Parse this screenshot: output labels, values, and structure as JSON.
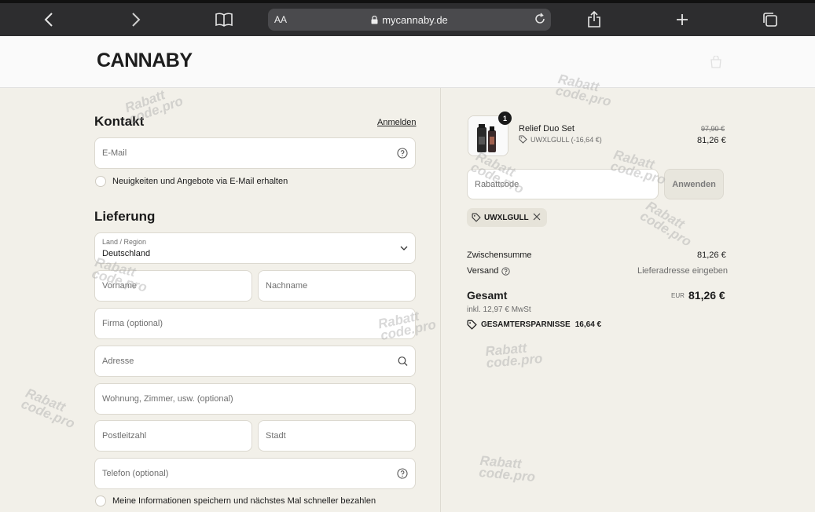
{
  "browser": {
    "aa_label": "AA",
    "url": "mycannaby.de"
  },
  "site": {
    "logo": "CANNABY"
  },
  "contact": {
    "title": "Kontakt",
    "login_link": "Anmelden",
    "email_placeholder": "E-Mail",
    "newsletter_label": "Neuigkeiten und Angebote via E-Mail erhalten"
  },
  "delivery": {
    "title": "Lieferung",
    "country_label": "Land / Region",
    "country_value": "Deutschland",
    "first_name": "Vorname",
    "last_name": "Nachname",
    "company": "Firma (optional)",
    "address": "Adresse",
    "apartment": "Wohnung, Zimmer, usw. (optional)",
    "postal_code": "Postleitzahl",
    "city": "Stadt",
    "phone": "Telefon (optional)",
    "save_info_label": "Meine Informationen speichern und nächstes Mal schneller bezahlen"
  },
  "summary": {
    "item": {
      "quantity": "1",
      "name": "Relief Duo Set",
      "discount": "UWXLGULL (-16,64 €)",
      "original_price": "97,90 €",
      "price": "81,26 €"
    },
    "discount_placeholder": "Rabattcode",
    "apply_button": "Anwenden",
    "applied_code": "UWXLGULL",
    "subtotal_label": "Zwischensumme",
    "subtotal_value": "81,26 €",
    "shipping_label": "Versand",
    "shipping_value": "Lieferadresse eingeben",
    "total_label": "Gesamt",
    "currency": "EUR",
    "total_value": "81,26 €",
    "tax_note": "inkl. 12,97 € MwSt",
    "savings_label": "GESAMTERSPARNISSE",
    "savings_value": "16,64 €"
  },
  "watermark": {
    "line1": "Rabatt",
    "line2": "code.pro"
  },
  "colors": {
    "page_bg": "#f3f1ea",
    "browser_bar": "#2d2d2f",
    "text": "#1c1c1c"
  }
}
